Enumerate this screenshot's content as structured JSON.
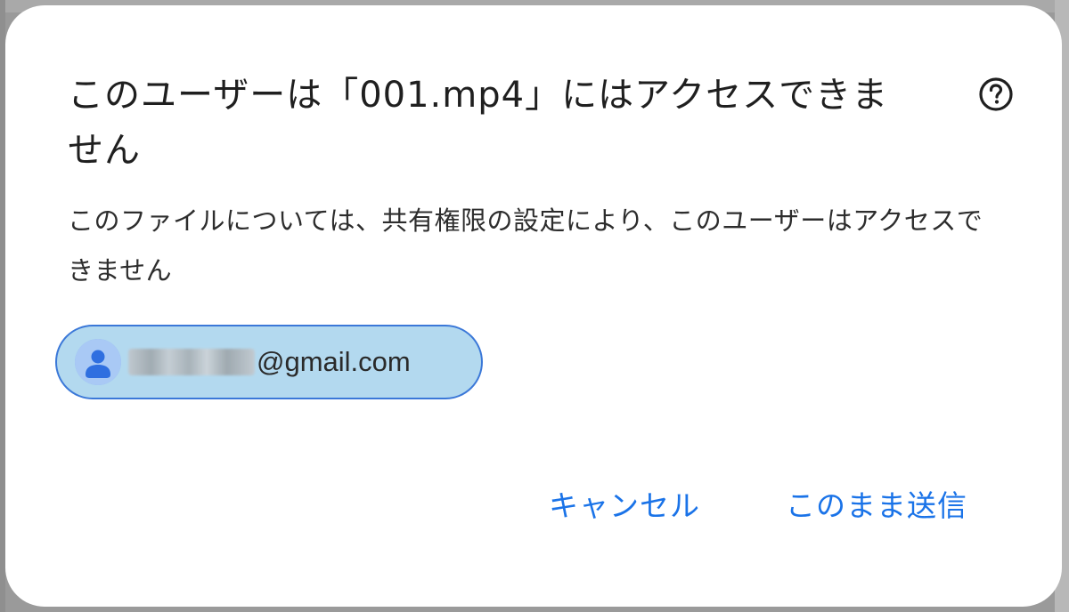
{
  "dialog": {
    "title": "このユーザーは「001.mp4」にはアクセスできません",
    "description": "このファイルについては、共有権限の設定により、このユーザーはアクセスできません",
    "help_icon": "help-circle-icon",
    "chip": {
      "avatar_icon": "person-icon",
      "email_domain": "@gmail.com"
    },
    "actions": {
      "cancel_label": "キャンセル",
      "send_label": "このまま送信"
    }
  },
  "colors": {
    "accent": "#1a73e8",
    "chip_background": "#b3d9ef",
    "chip_border": "#3b78d8",
    "dialog_background": "#ffffff",
    "text_primary": "#1f1f1f"
  }
}
